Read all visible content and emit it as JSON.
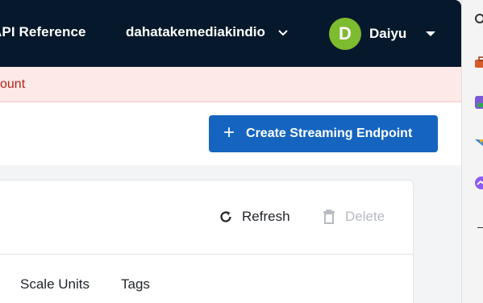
{
  "header": {
    "api_reference": "API Reference",
    "account_name": "dahatakemediakindio",
    "user_initial": "D",
    "user_name": "Daiyu"
  },
  "alert": {
    "text": "ount"
  },
  "toolbar": {
    "create_label": "Create Streaming Endpoint"
  },
  "table": {
    "refresh_label": "Refresh",
    "delete_label": "Delete",
    "columns": [
      "Scale Units",
      "Tags"
    ]
  },
  "colors": {
    "header_bg": "#06182b",
    "avatar": "#7dbb2f",
    "primary": "#1565c0",
    "alert_bg": "#fce9e8",
    "alert_text": "#b42318",
    "disabled": "#b7bbc2"
  }
}
